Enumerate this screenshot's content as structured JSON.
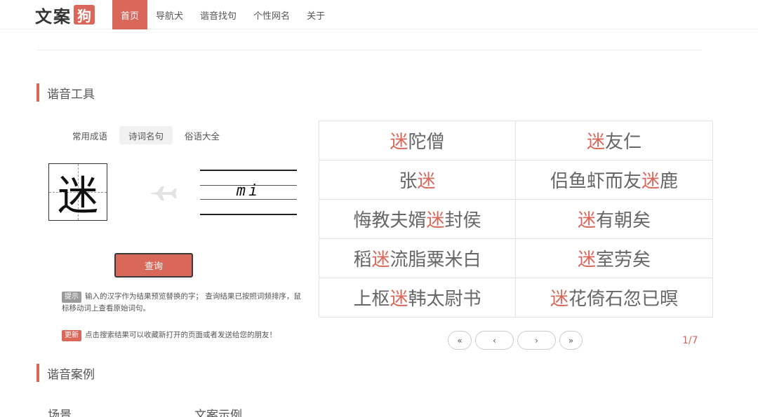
{
  "header": {
    "logo_text": "文案",
    "logo_badge": "狗",
    "nav": [
      "首页",
      "导航犬",
      "谐音找句",
      "个性网名",
      "关于"
    ],
    "active_nav": 0
  },
  "sections": {
    "tool_title": "谐音工具",
    "case_title": "谐音案例"
  },
  "tool": {
    "tabs": [
      "常用成语",
      "诗词名句",
      "俗语大全"
    ],
    "active_tab": 1,
    "input_char": "迷",
    "pinyin": "mi",
    "query_label": "查询",
    "tip_tag": "提示",
    "tip_text": "输入的汉字作为结果预览替换的字；  查询结果已按照词频排序，鼠标移动词上查看原始词句。",
    "update_tag": "更新",
    "update_text": "点击搜索结果可以收藏新打开的页面或者发送给您的朋友！"
  },
  "results": [
    {
      "pre": "",
      "hl": "迷",
      "post": "陀僧"
    },
    {
      "pre": "",
      "hl": "迷",
      "post": "友仁"
    },
    {
      "pre": "张",
      "hl": "迷",
      "post": ""
    },
    {
      "pre": "侣鱼虾而友",
      "hl": "迷",
      "post": "鹿"
    },
    {
      "pre": "悔教夫婿",
      "hl": "迷",
      "post": "封侯"
    },
    {
      "pre": "",
      "hl": "迷",
      "post": "有朝矣"
    },
    {
      "pre": "稻",
      "hl": "迷",
      "post": "流脂粟米白"
    },
    {
      "pre": "",
      "hl": "迷",
      "post": "室劳矣"
    },
    {
      "pre": "上枢",
      "hl": "迷",
      "post": "韩太尉书"
    },
    {
      "pre": "",
      "hl": "迷",
      "post": "花倚石忽已暝"
    }
  ],
  "pager": {
    "first": "«",
    "prev": "‹",
    "next": "›",
    "last": "»",
    "page_info": "1/7"
  },
  "case_table": {
    "col1": "场景",
    "col2": "文案示例"
  },
  "colors": {
    "accent": "#d9685a"
  }
}
